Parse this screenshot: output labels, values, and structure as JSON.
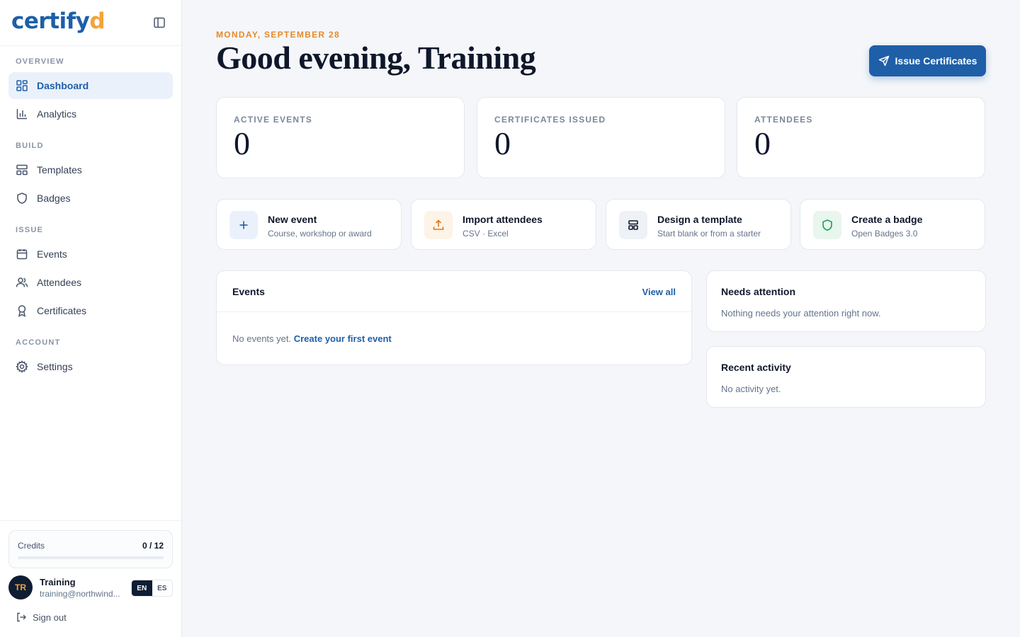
{
  "brand": {
    "name_main": "certify",
    "name_accent": "d"
  },
  "sidebar": {
    "sections": {
      "overview": "OVERVIEW",
      "build": "BUILD",
      "issue": "ISSUE",
      "account": "ACCOUNT"
    },
    "items": {
      "dashboard": "Dashboard",
      "analytics": "Analytics",
      "templates": "Templates",
      "badges": "Badges",
      "events": "Events",
      "attendees": "Attendees",
      "certificates": "Certificates",
      "settings": "Settings"
    },
    "credits": {
      "label": "Credits",
      "value": "0 / 12",
      "used_fraction": 0
    },
    "user": {
      "initials": "TR",
      "name": "Training",
      "email": "training@northwind..."
    },
    "languages": {
      "en": "EN",
      "es": "ES",
      "selected": "EN"
    },
    "signout": "Sign out"
  },
  "header": {
    "date": "MONDAY, SEPTEMBER 28",
    "greeting": "Good evening, Training",
    "issue_button": "Issue Certificates"
  },
  "stats": [
    {
      "label": "ACTIVE EVENTS",
      "value": "0"
    },
    {
      "label": "CERTIFICATES ISSUED",
      "value": "0"
    },
    {
      "label": "ATTENDEES",
      "value": "0"
    }
  ],
  "actions": [
    {
      "title": "New event",
      "subtitle": "Course, workshop or award"
    },
    {
      "title": "Import attendees",
      "subtitle": "CSV · Excel"
    },
    {
      "title": "Design a template",
      "subtitle": "Start blank or from a starter"
    },
    {
      "title": "Create a badge",
      "subtitle": "Open Badges 3.0"
    }
  ],
  "events_panel": {
    "title": "Events",
    "view_all": "View all",
    "empty_text": "No events yet.",
    "empty_link": "Create your first event"
  },
  "attention_panel": {
    "title": "Needs attention",
    "text": "Nothing needs your attention right now."
  },
  "activity_panel": {
    "title": "Recent activity",
    "text": "No activity yet."
  },
  "colors": {
    "primary": "#1e5fa8",
    "accent": "#f3a33a",
    "date": "#e58a2b"
  }
}
